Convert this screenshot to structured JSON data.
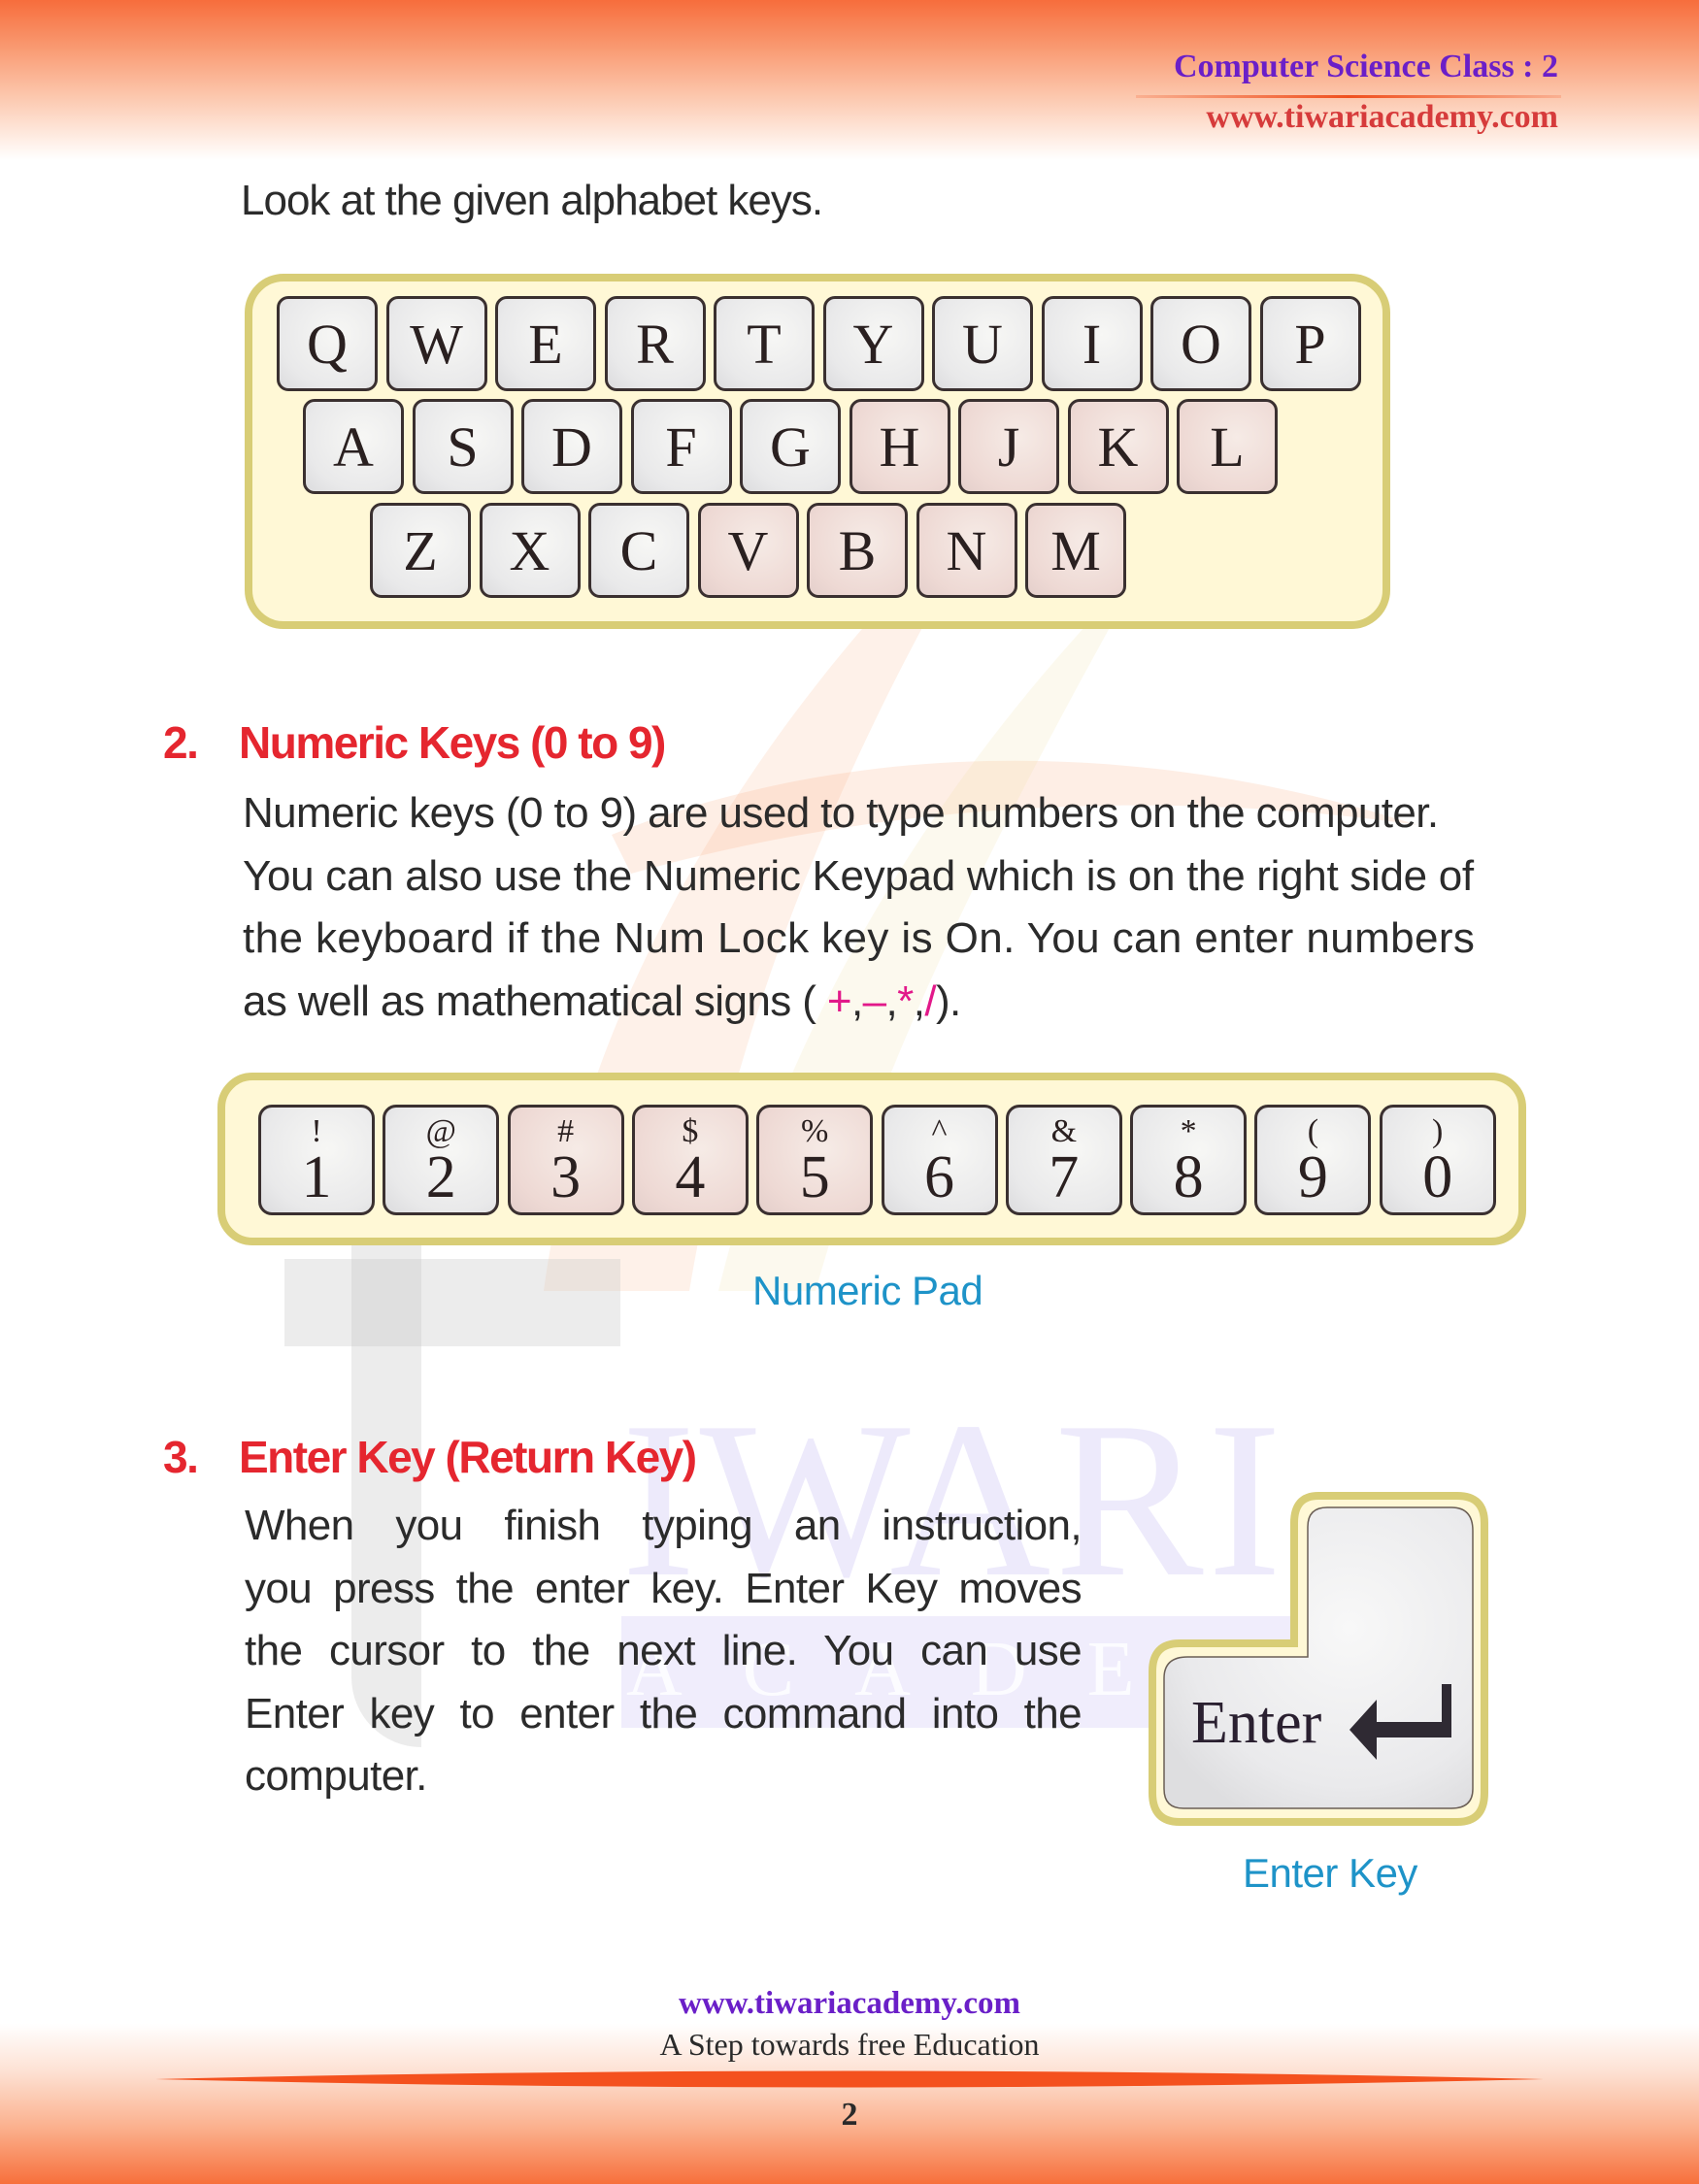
{
  "header": {
    "title": "Computer Science Class : 2",
    "url": "www.tiwariacademy.com"
  },
  "intro": "Look at the given alphabet keys.",
  "alphabet_keyboard": {
    "rows": [
      [
        "Q",
        "W",
        "E",
        "R",
        "T",
        "Y",
        "U",
        "I",
        "O",
        "P"
      ],
      [
        "A",
        "S",
        "D",
        "F",
        "G",
        "H",
        "J",
        "K",
        "L"
      ],
      [
        "Z",
        "X",
        "C",
        "V",
        "B",
        "N",
        "M"
      ]
    ]
  },
  "section2": {
    "number": "2.",
    "title": "Numeric Keys (0 to 9)",
    "lines": [
      "Numeric keys (0 to 9) are used to type numbers on the computer.",
      "You can also use the Numeric Keypad which is on the right side of",
      "the keyboard if the Num Lock key is On. You can enter numbers"
    ],
    "last_line_prefix": "as well as mathematical signs ( ",
    "signs": [
      "+",
      ",",
      "–",
      ",",
      "*",
      ",",
      "/"
    ],
    "last_line_suffix": ").",
    "caption": "Numeric Pad"
  },
  "numeric_keys": [
    {
      "symbol": "!",
      "digit": "1"
    },
    {
      "symbol": "@",
      "digit": "2"
    },
    {
      "symbol": "#",
      "digit": "3"
    },
    {
      "symbol": "$",
      "digit": "4"
    },
    {
      "symbol": "%",
      "digit": "5"
    },
    {
      "symbol": "^",
      "digit": "6"
    },
    {
      "symbol": "&",
      "digit": "7"
    },
    {
      "symbol": "*",
      "digit": "8"
    },
    {
      "symbol": "(",
      "digit": "9"
    },
    {
      "symbol": ")",
      "digit": "0"
    }
  ],
  "section3": {
    "number": "3.",
    "title": "Enter Key (Return Key)",
    "lines": [
      "When you finish typing an instruction,",
      "you press the enter key. Enter Key moves",
      "the cursor to the next line. You can use",
      "Enter key to enter the command into the",
      "computer."
    ],
    "enter_key_label": "Enter",
    "enter_key_icon": "return-arrow-icon",
    "caption": "Enter Key"
  },
  "watermark": {
    "letter": "T",
    "word": "IWARI",
    "sub": "ACADEMY"
  },
  "footer": {
    "url": "www.tiwariacademy.com",
    "tagline": "A Step towards free Education",
    "page_number": "2"
  },
  "colors": {
    "heading_red": "#e5262f",
    "caption_blue": "#1e93c8",
    "header_purple": "#6a1fc8",
    "url_red": "#d63b3b",
    "sign_pink": "#e2198a",
    "frame_olive": "#d8cd76",
    "band_orange": "#f76d3c"
  }
}
